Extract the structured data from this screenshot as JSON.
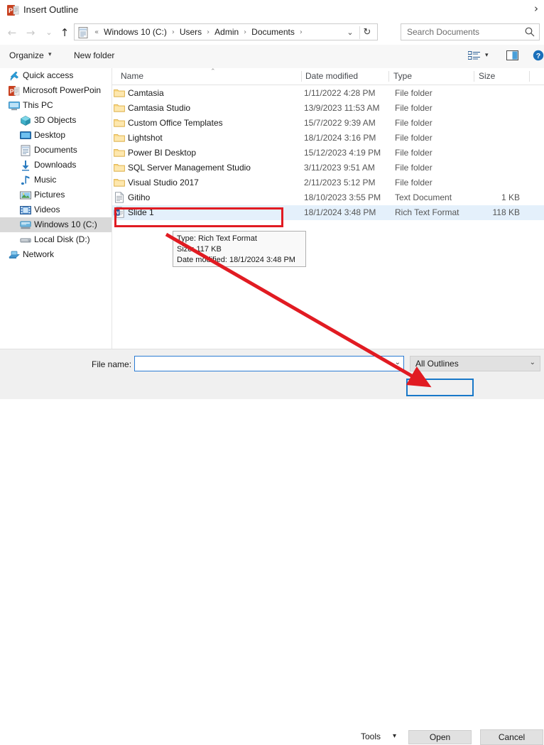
{
  "window": {
    "title": "Insert Outline",
    "app_icon": "powerpoint-icon",
    "close_glyph": "›"
  },
  "nav": {
    "back": "←",
    "forward": "→",
    "history": "⌄",
    "up": "↑",
    "refresh": "↻",
    "dropdown": "⌄"
  },
  "address": {
    "icon": "documents-folder-icon",
    "prefix": "«",
    "crumbs": [
      "Windows 10 (C:)",
      "Users",
      "Admin",
      "Documents"
    ],
    "separator": "›",
    "trailing_separator": "›"
  },
  "search": {
    "placeholder": "Search Documents",
    "value": "Search Documents",
    "icon": "search-icon"
  },
  "command_bar": {
    "organize": "Organize",
    "organize_caret": "▾",
    "new_folder": "New folder",
    "view_caret": "▾",
    "view_icon": "view-list-icon",
    "preview_pane_icon": "preview-pane-icon",
    "help_icon": "help-icon"
  },
  "sidebar": {
    "items": [
      {
        "label": "Quick access",
        "icon": "pin-star-icon",
        "level": 0,
        "selected": false
      },
      {
        "label": "Microsoft PowerPoin",
        "icon": "powerpoint-icon",
        "level": 0,
        "selected": false
      },
      {
        "label": "This PC",
        "icon": "computer-icon",
        "level": 0,
        "selected": false
      },
      {
        "label": "3D Objects",
        "icon": "3d-objects-icon",
        "level": 1,
        "selected": false
      },
      {
        "label": "Desktop",
        "icon": "desktop-icon",
        "level": 1,
        "selected": false
      },
      {
        "label": "Documents",
        "icon": "documents-icon",
        "level": 1,
        "selected": false
      },
      {
        "label": "Downloads",
        "icon": "downloads-icon",
        "level": 1,
        "selected": false
      },
      {
        "label": "Music",
        "icon": "music-icon",
        "level": 1,
        "selected": false
      },
      {
        "label": "Pictures",
        "icon": "pictures-icon",
        "level": 1,
        "selected": false
      },
      {
        "label": "Videos",
        "icon": "videos-icon",
        "level": 1,
        "selected": false
      },
      {
        "label": "Windows 10 (C:)",
        "icon": "local-drive-icon",
        "level": 1,
        "selected": true
      },
      {
        "label": "Local Disk (D:)",
        "icon": "disk-drive-icon",
        "level": 1,
        "selected": false
      },
      {
        "label": "Network",
        "icon": "network-icon",
        "level": 0,
        "selected": false
      }
    ]
  },
  "file_list": {
    "columns": [
      "Name",
      "Date modified",
      "Type",
      "Size"
    ],
    "sort_caret": "⌃",
    "rows": [
      {
        "name": "Camtasia",
        "date": "1/11/2022 4:28 PM",
        "type": "File folder",
        "size": "",
        "icon": "folder-icon",
        "selected": false
      },
      {
        "name": "Camtasia Studio",
        "date": "13/9/2023 11:53 AM",
        "type": "File folder",
        "size": "",
        "icon": "folder-icon",
        "selected": false
      },
      {
        "name": "Custom Office Templates",
        "date": "15/7/2022 9:39 AM",
        "type": "File folder",
        "size": "",
        "icon": "folder-icon",
        "selected": false
      },
      {
        "name": "Lightshot",
        "date": "18/1/2024 3:16 PM",
        "type": "File folder",
        "size": "",
        "icon": "folder-icon",
        "selected": false
      },
      {
        "name": "Power BI Desktop",
        "date": "15/12/2023 4:19 PM",
        "type": "File folder",
        "size": "",
        "icon": "folder-icon",
        "selected": false
      },
      {
        "name": "SQL Server Management Studio",
        "date": "3/11/2023 9:51 AM",
        "type": "File folder",
        "size": "",
        "icon": "folder-icon",
        "selected": false
      },
      {
        "name": "Visual Studio 2017",
        "date": "2/11/2023 5:12 PM",
        "type": "File folder",
        "size": "",
        "icon": "folder-icon",
        "selected": false
      },
      {
        "name": "Gitiho",
        "date": "18/10/2023 3:55 PM",
        "type": "Text Document",
        "size": "1 KB",
        "icon": "text-file-icon",
        "selected": false
      },
      {
        "name": "Slide 1",
        "date": "18/1/2024 3:48 PM",
        "type": "Rich Text Format",
        "size": "118 KB",
        "icon": "rtf-file-icon",
        "selected": true
      }
    ]
  },
  "tooltip": {
    "type_line": "Type: Rich Text Format",
    "size_line": "Size: 117 KB",
    "date_line": "Date modified: 18/1/2024 3:48 PM"
  },
  "bottom": {
    "file_name_label": "File name:",
    "file_name_value": "",
    "file_name_placeholder": "",
    "file_name_caret": "⌄",
    "filter_value": "All Outlines",
    "filter_caret": "⌄",
    "tools_label": "Tools",
    "tools_caret": "▾",
    "open_label": "Open",
    "cancel_label": "Cancel"
  },
  "annotation": {
    "highlight_color": "#e11b22",
    "focus_color": "#1878c8",
    "selection_color": "#e4f0fb"
  }
}
